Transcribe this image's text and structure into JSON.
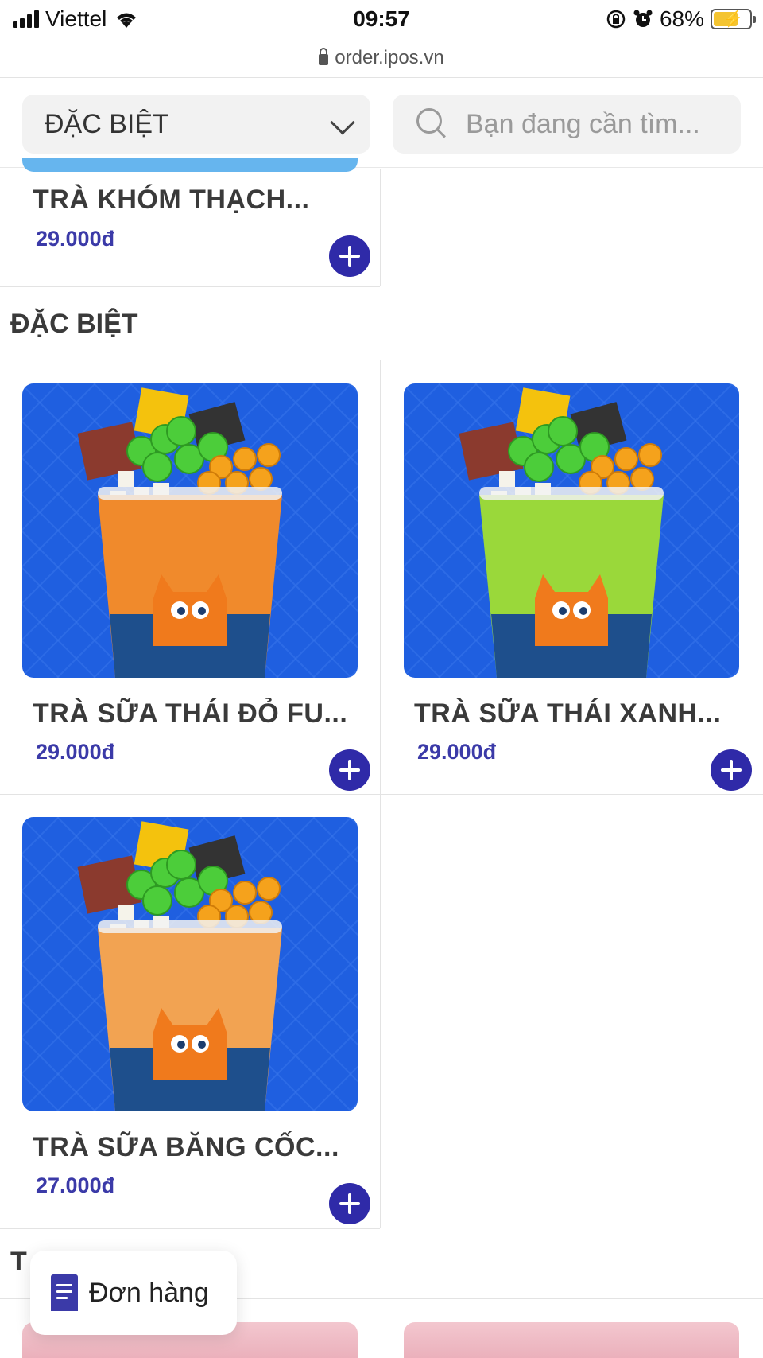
{
  "status_bar": {
    "carrier": "Viettel",
    "time": "09:57",
    "battery": "68%"
  },
  "browser": {
    "url": "order.ipos.vn"
  },
  "filter": {
    "category_selected": "ĐẶC BIỆT",
    "search_placeholder": "Bạn đang cần tìm..."
  },
  "previous_item": {
    "name": "TRÀ KHÓM THẠCH...",
    "price": "29.000đ"
  },
  "section": {
    "title": "ĐẶC BIỆT",
    "items": [
      {
        "name": "TRÀ SỮA THÁI ĐỎ FU...",
        "price": "29.000đ",
        "tea_color": "#f08a2c"
      },
      {
        "name": "TRÀ SỮA THÁI XANH...",
        "price": "29.000đ",
        "tea_color": "#9ad83a"
      },
      {
        "name": "TRÀ SỮA BĂNG CỐC...",
        "price": "27.000đ",
        "tea_color": "#f2a352"
      }
    ]
  },
  "next_section": {
    "title_partial": "T"
  },
  "order_button": {
    "label": "Đơn hàng"
  },
  "colors": {
    "accent": "#2f2aa8",
    "price": "#3b3aa8",
    "image_bg": "#1f5fe0"
  }
}
